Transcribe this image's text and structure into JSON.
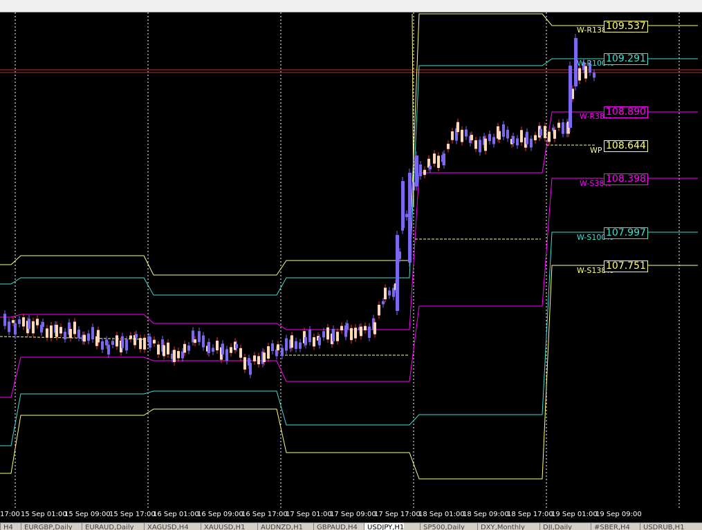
{
  "chart": {
    "symbol": "USDJPY",
    "timeframe": "H1",
    "grid": true,
    "colors": {
      "background": "#000000",
      "bull_candle": "#7b68ee",
      "bear_candle": "#ffdab9",
      "bear_wick": "#ff3030",
      "hline": "#c83232",
      "r138": "#ffff80",
      "r100": "#40e0d0",
      "r38": "#ff00ff",
      "wp": "#ffffff",
      "grid": "#ffffff"
    },
    "levels": [
      {
        "id": "r138",
        "name": "W-R138%",
        "price": "109.537",
        "color": "#ffff80"
      },
      {
        "id": "r100",
        "name": "W-R100%",
        "price": "109.291",
        "color": "#40e0d0"
      },
      {
        "id": "r38",
        "name": "W-R38%",
        "price": "108.890",
        "color": "#ff00ff"
      },
      {
        "id": "wp",
        "name": "WP",
        "price": "108.644",
        "color": "#ffff80"
      },
      {
        "id": "s38",
        "name": "W-S38%",
        "price": "108.398",
        "color": "#ff00ff"
      },
      {
        "id": "s100",
        "name": "W-S100%",
        "price": "107.997",
        "color": "#40e0d0"
      },
      {
        "id": "s138",
        "name": "W-S138%",
        "price": "107.751",
        "color": "#ffff80"
      }
    ]
  },
  "time_axis": {
    "labels": [
      "17:00",
      "15 Sep 01:00",
      "15 Sep 09:00",
      "15 Sep 17:00",
      "16 Sep 01:00",
      "16 Sep 09:00",
      "16 Sep 17:00",
      "17 Sep 01:00",
      "17 Sep 09:00",
      "17 Sep 17:00",
      "18 Sep 01:00",
      "18 Sep 09:00",
      "18 Sep 17:00",
      "19 Sep 01:00",
      "19 Sep 09:00"
    ]
  },
  "tabs": [
    {
      "label": "H4",
      "active": false
    },
    {
      "label": "EURGBP,Daily",
      "active": false
    },
    {
      "label": "EURAUD,Daily",
      "active": false
    },
    {
      "label": "XAGUSD,H4",
      "active": false
    },
    {
      "label": "XAUUSD,H1",
      "active": false
    },
    {
      "label": "AUDNZD,H1",
      "active": false
    },
    {
      "label": "GBPAUD,H4",
      "active": false
    },
    {
      "label": "USDJPY,H1",
      "active": true
    },
    {
      "label": "SP500,Daily",
      "active": false
    },
    {
      "label": "DXY,Monthly",
      "active": false
    },
    {
      "label": "DJI,Daily",
      "active": false
    },
    {
      "label": "#SBER,H4",
      "active": false
    },
    {
      "label": "USDRUB,H1",
      "active": false
    }
  ]
}
